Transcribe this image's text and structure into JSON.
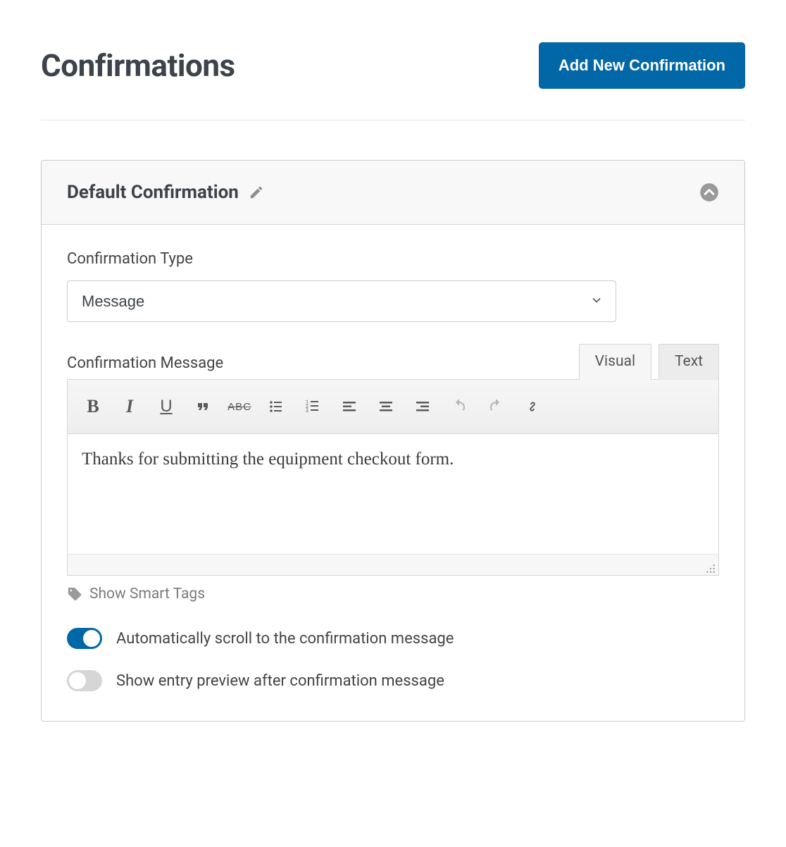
{
  "header": {
    "title": "Confirmations",
    "add_button": "Add New Confirmation"
  },
  "panel": {
    "title": "Default Confirmation",
    "type_label": "Confirmation Type",
    "type_value": "Message",
    "message_label": "Confirmation Message",
    "tabs": {
      "visual": "Visual",
      "text": "Text"
    },
    "toolbar": {
      "bold": "B",
      "italic": "I",
      "underline": "U",
      "strike": "ABC"
    },
    "message_content": "Thanks for submitting the equipment checkout form.",
    "smart_tags": "Show Smart Tags",
    "toggle_autoscroll": {
      "label": "Automatically scroll to the confirmation message",
      "on": true
    },
    "toggle_preview": {
      "label": "Show entry preview after confirmation message",
      "on": false
    }
  }
}
